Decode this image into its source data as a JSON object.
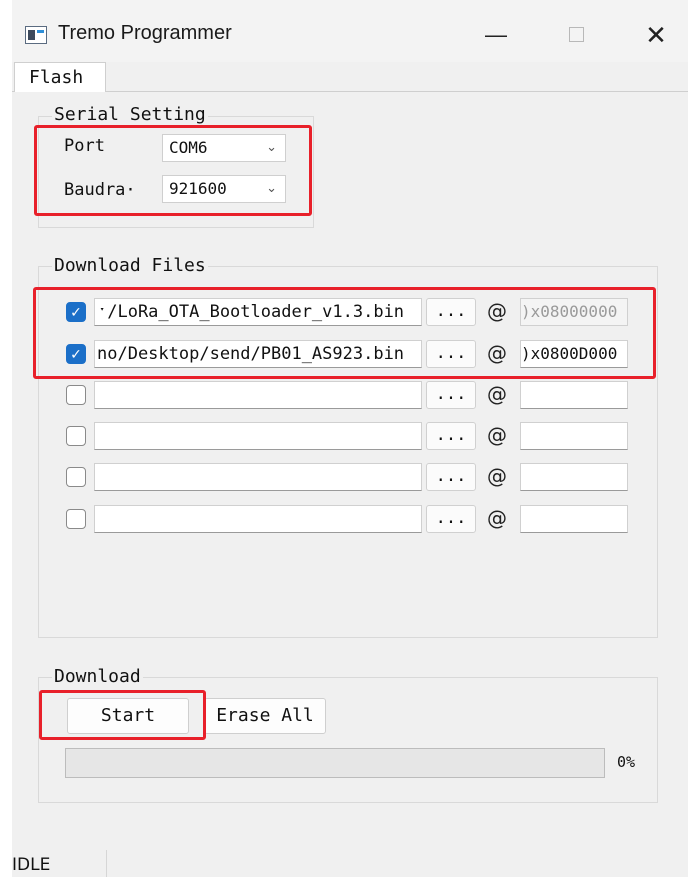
{
  "window": {
    "title": "Tremo Programmer",
    "icon": "app-icon"
  },
  "tabs": [
    {
      "label": "Flash",
      "selected": true
    }
  ],
  "serial": {
    "legend": "Serial Setting",
    "port_label": "Port",
    "port_value": "COM6",
    "baud_label": "Baudra·",
    "baud_value": "921600"
  },
  "download_files": {
    "legend": "Download Files",
    "browse_label": "...",
    "at_symbol": "@",
    "rows": [
      {
        "checked": true,
        "path": "ˑ/LoRa_OTA_Bootloader_v1.3.bin",
        "address": ")x08000000",
        "address_disabled": true
      },
      {
        "checked": true,
        "path": "no/Desktop/send/PB01_AS923.bin",
        "address": ")x0800D000",
        "address_disabled": false
      },
      {
        "checked": false,
        "path": "",
        "address": "",
        "address_disabled": false
      },
      {
        "checked": false,
        "path": "",
        "address": "",
        "address_disabled": false
      },
      {
        "checked": false,
        "path": "",
        "address": "",
        "address_disabled": false
      },
      {
        "checked": false,
        "path": "",
        "address": "",
        "address_disabled": false
      }
    ]
  },
  "download": {
    "legend": "Download",
    "start_label": "Start",
    "erase_label": "Erase All",
    "progress_fraction": 0,
    "progress_text": "0%"
  },
  "status": {
    "text": "IDLE"
  },
  "colors": {
    "highlight": "#e8202a",
    "checkbox": "#1b6fc8",
    "progress_fill": "#06b025"
  }
}
